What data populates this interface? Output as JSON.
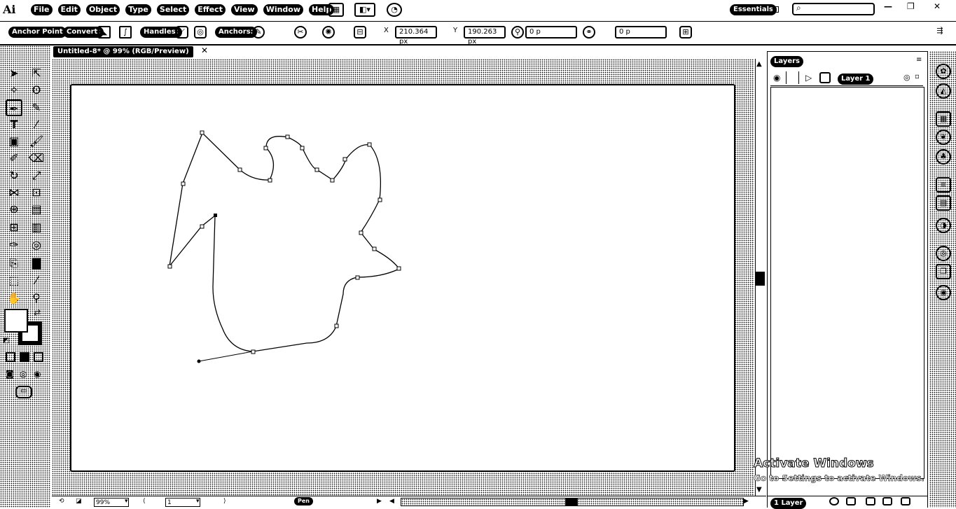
{
  "app": {
    "logo": "Ai"
  },
  "menu": [
    "File",
    "Edit",
    "Object",
    "Type",
    "Select",
    "Effect",
    "View",
    "Window",
    "Help"
  ],
  "workspace": {
    "label": "Essentials"
  },
  "search": {
    "placeholder": ""
  },
  "window_controls": {
    "minimize": "—",
    "restore": "❐",
    "close": "✕"
  },
  "control_bar": {
    "anchor_point_label": "Anchor Point",
    "convert_label": "Convert:",
    "handles_label": "Handles:",
    "anchors_label": "Anchors:",
    "x_value": "210.364 px",
    "y_value": "190.263 px",
    "w_value": "0 p",
    "h_value": "0 p"
  },
  "document": {
    "tab_title": "Untitled-8* @ 99% (RGB/Preview)"
  },
  "status_bar": {
    "zoom": "99%",
    "artboard_number": "1",
    "tool_name": "Pen"
  },
  "layers_panel": {
    "tab_label": "Layers",
    "layer_name": "Layer 1",
    "layer_count": "1 Layer"
  },
  "watermark": {
    "title": "Activate Windows",
    "subtitle": "Go to Settings to activate Windows."
  },
  "icons": {
    "toolbox": [
      "selection-tool-icon",
      "direct-selection-tool-icon",
      "magic-wand-tool-icon",
      "lasso-tool-icon",
      "pen-tool-icon",
      "curvature-tool-icon",
      "type-tool-icon",
      "line-segment-tool-icon",
      "rectangle-tool-icon",
      "paintbrush-tool-icon",
      "shaper-tool-icon",
      "eraser-tool-icon",
      "rotate-tool-icon",
      "scale-tool-icon",
      "width-tool-icon",
      "free-transform-tool-icon",
      "shape-builder-tool-icon",
      "perspective-grid-tool-icon",
      "mesh-tool-icon",
      "gradient-tool-icon",
      "eyedropper-tool-icon",
      "blend-tool-icon",
      "symbol-sprayer-tool-icon",
      "column-graph-tool-icon",
      "artboard-tool-icon",
      "slice-tool-icon",
      "hand-tool-icon",
      "zoom-tool-icon"
    ],
    "dock": [
      "color-icon",
      "color-guide-icon",
      "swatches-icon",
      "brushes-icon",
      "symbols-icon",
      "stroke-icon",
      "gradient-icon",
      "transparency-icon",
      "appearance-icon",
      "graphic-styles-icon",
      "libraries-icon"
    ]
  },
  "colors": {
    "ink": "#000000",
    "paper": "#ffffff"
  }
}
